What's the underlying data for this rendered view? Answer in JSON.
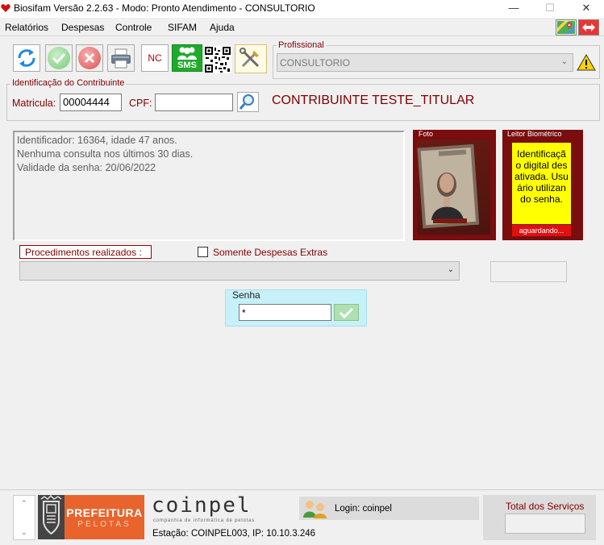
{
  "window": {
    "title": "Biosifam Versão 2.2.63 - Modo: Pronto Atendimento - CONSULTORIO",
    "minimize": "—",
    "maximize": "☐",
    "close": "✕"
  },
  "menu": [
    "Relatórios",
    "Despesas",
    "Controle",
    "SIFAM",
    "Ajuda"
  ],
  "toolbar": {
    "nc_label": "NC",
    "sms_label": "SMS"
  },
  "profissional": {
    "label": "Profissional",
    "value": "CONSULTORIO"
  },
  "contribuinte": {
    "group_label": "Identificação do Contribuinte",
    "matricula_label": "Matricula:",
    "matricula_value": "00004444",
    "cpf_label": "CPF:",
    "cpf_value": "",
    "name": "CONTRIBUINTE TESTE_TITULAR"
  },
  "info_lines": [
    "Identificador: 16364, idade 47 anos.",
    "Nenhuma consulta nos últimos 30 dias.",
    "Validade da senha: 20/06/2022"
  ],
  "foto": {
    "label": "Foto"
  },
  "biometrico": {
    "label": "Leitor Biométrico",
    "message": "Identificação digital desativada. Usuário utilizando senha.",
    "status": "aguardando..."
  },
  "procedimentos": {
    "label": "Procedimentos realizados :",
    "somente_extras": "Somente Despesas Extras",
    "selected": ""
  },
  "senha": {
    "label": "Senha",
    "value": "*"
  },
  "footer": {
    "prefeitura_line1": "PREFEITURA",
    "prefeitura_line2": "PELOTAS",
    "coinpel_logo": "coinpel",
    "coinpel_sub": "companhia de informática de pelotas",
    "estacao": "Estação: COINPEL003, IP: 10.10.3.246",
    "login": "Login: coinpel",
    "total_label": "Total dos Serviços",
    "total_value": ""
  },
  "colors": {
    "accent_dark_red": "#800000",
    "photo_frame": "#7a0d0d",
    "biometric_yellow": "#ffff00",
    "status_red": "#e01010",
    "senha_bg": "#c6f1f8",
    "prefeitura_orange": "#e8642c"
  }
}
